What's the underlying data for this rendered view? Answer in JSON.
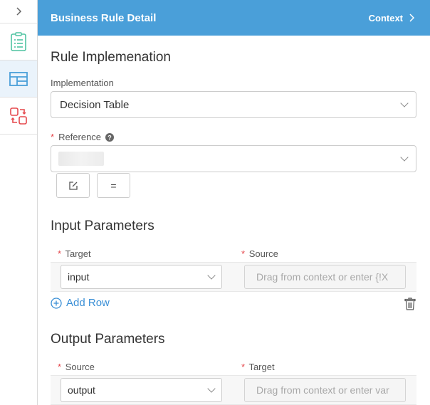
{
  "header": {
    "title": "Business Rule Detail",
    "context_label": "Context"
  },
  "sidebar": {
    "items": [
      {
        "icon": "checklist-icon",
        "color": "#4fc3a1"
      },
      {
        "icon": "table-layout-icon",
        "color": "#4a9fd9",
        "active": true
      },
      {
        "icon": "transform-icon",
        "color": "#e5484d"
      }
    ]
  },
  "implementation": {
    "section_title": "Rule Implemenation",
    "implementation_label": "Implementation",
    "implementation_value": "Decision Table",
    "reference_label": "Reference",
    "required_marker": "*",
    "reference_value": "",
    "equals_button_label": "="
  },
  "input_parameters": {
    "section_title": "Input Parameters",
    "columns": [
      "Target",
      "Source"
    ],
    "rows": [
      {
        "target": "input",
        "source_placeholder": "Drag from context or enter {!X"
      }
    ],
    "add_row_label": "Add Row"
  },
  "output_parameters": {
    "section_title": "Output Parameters",
    "columns": [
      "Source",
      "Target"
    ],
    "rows": [
      {
        "source": "output",
        "target_placeholder": "Drag from context or enter var"
      }
    ]
  },
  "colors": {
    "header": "#4a9fd9",
    "accent": "#3a8fd6",
    "required": "#e5484d"
  }
}
